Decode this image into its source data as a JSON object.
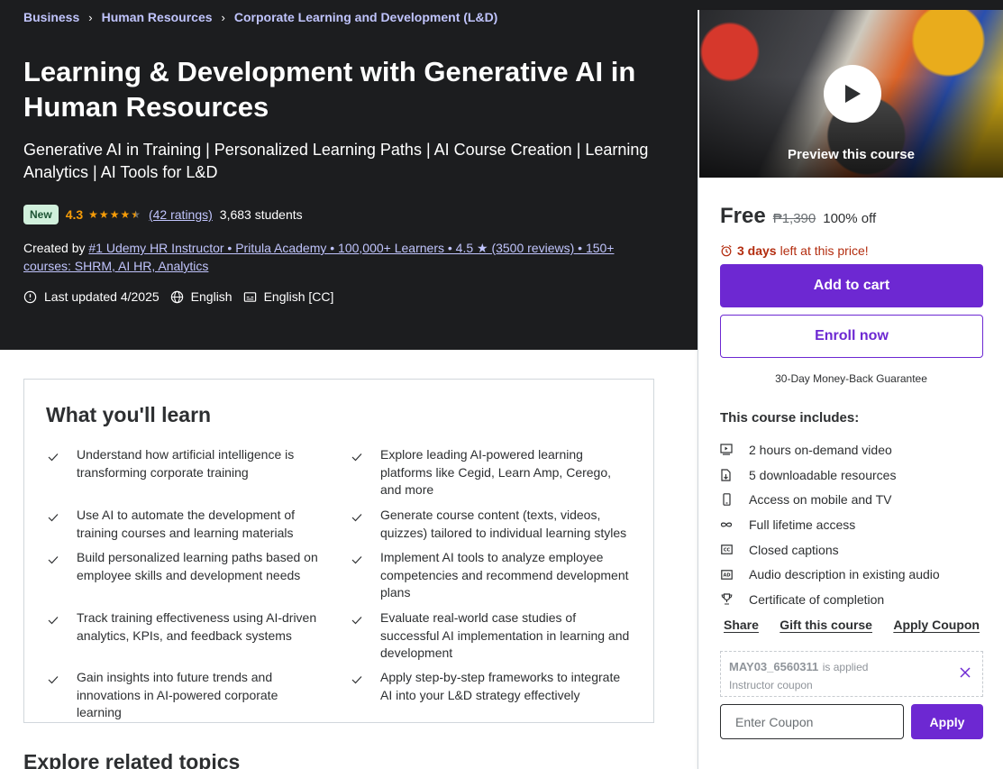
{
  "breadcrumb": [
    "Business",
    "Human Resources",
    "Corporate Learning and Development (L&D)"
  ],
  "course": {
    "title": "Learning & Development with Generative AI in Human Resources",
    "subtitle": "Generative AI in Training | Personalized Learning Paths | AI Course Creation | Learning Analytics | AI Tools for L&D",
    "badge": "New",
    "rating": "4.3",
    "rating_stars": 4.3,
    "ratings_count": "(42 ratings)",
    "students": "3,683 students",
    "created_by_label": "Created by",
    "instructor": "#1 Udemy HR Instructor • Pritula Academy • 100,000+ Learners • 4.5 ★ (3500 reviews) • 150+ courses: SHRM, AI HR, Analytics",
    "last_updated": "Last updated 4/2025",
    "language": "English",
    "captions": "English [CC]"
  },
  "sidebar": {
    "preview_label": "Preview this course",
    "price": "Free",
    "original_price": "₱1,390",
    "discount": "100% off",
    "timer_bold": "3 days",
    "timer_text": "left at this price!",
    "add_to_cart": "Add to cart",
    "enroll_now": "Enroll now",
    "guarantee": "30-Day Money-Back Guarantee",
    "includes_title": "This course includes:",
    "includes": [
      {
        "icon": "video-icon",
        "label": "2 hours on-demand video"
      },
      {
        "icon": "file-download-icon",
        "label": "5 downloadable resources"
      },
      {
        "icon": "mobile-icon",
        "label": "Access on mobile and TV"
      },
      {
        "icon": "infinity-icon",
        "label": "Full lifetime access"
      },
      {
        "icon": "closed-captions-icon",
        "label": "Closed captions"
      },
      {
        "icon": "audio-description-icon",
        "label": "Audio description in existing audio"
      },
      {
        "icon": "trophy-icon",
        "label": "Certificate of completion"
      }
    ],
    "links": {
      "share": "Share",
      "gift": "Gift this course",
      "apply_coupon": "Apply Coupon"
    },
    "coupon": {
      "code": "MAY03_6560311",
      "applied_text": "is applied",
      "type": "Instructor coupon"
    },
    "coupon_placeholder": "Enter Coupon",
    "apply": "Apply"
  },
  "learn": {
    "title": "What you'll learn",
    "items": [
      "Understand how artificial intelligence is transforming corporate training",
      "Explore leading AI-powered learning platforms like Cegid, Learn Amp, Cerego, and more",
      "Use AI to automate the development of training courses and learning materials",
      "Generate course content (texts, videos, quizzes) tailored to individual learning styles",
      "Build personalized learning paths based on employee skills and development needs",
      "Implement AI tools to analyze employee competencies and recommend development plans",
      "Track training effectiveness using AI-driven analytics, KPIs, and feedback systems",
      "Evaluate real-world case studies of successful AI implementation in learning and development",
      "Gain insights into future trends and innovations in AI-powered corporate learning",
      "Apply step-by-step frameworks to integrate AI into your L&D strategy effectively"
    ]
  },
  "related_title": "Explore related topics",
  "colors": {
    "hero_bg": "#1c1d1f",
    "accent_purple": "#6d28d2",
    "link_lavender": "#c0c4fc",
    "star_orange": "#f69c08",
    "alert_red": "#b32d0f"
  }
}
